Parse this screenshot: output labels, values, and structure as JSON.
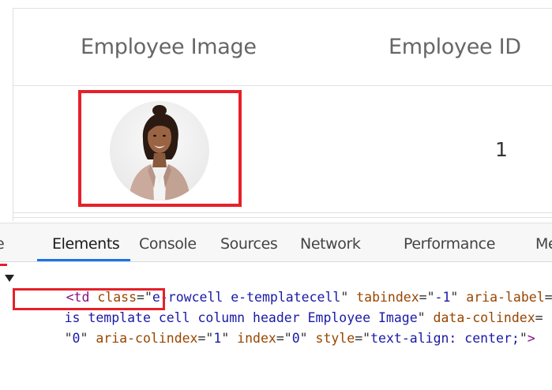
{
  "grid": {
    "columns": [
      {
        "label": "Employee Image"
      },
      {
        "label": "Employee ID"
      }
    ],
    "rows": [
      {
        "employee_id": "1",
        "image_icon": "employee-photo"
      }
    ]
  },
  "devtools": {
    "tabs": [
      {
        "label": "e",
        "partial": true
      },
      {
        "label": "Elements",
        "active": true
      },
      {
        "label": "Console"
      },
      {
        "label": "Sources"
      },
      {
        "label": "Network"
      },
      {
        "label": "Performance"
      },
      {
        "label": "Me",
        "partial": true
      }
    ],
    "code": {
      "line1": {
        "open": "<",
        "tag": "td",
        "a1_name": " class",
        "a1_eq": "=\"",
        "a1_val": "e-rowcell e-templatecell",
        "a1_end": "\"",
        "a2_name": " tabindex",
        "a2_eq": "=\"",
        "a2_val": "-1",
        "a2_end": "\"",
        "a3_name": " aria-label",
        "a3_eq": "="
      },
      "line2": {
        "highlighted": "is template cell",
        "rest_val": " column header Employee Image",
        "end": "\"",
        "a_name": " data-colindex",
        "a_eq": "="
      },
      "line3": {
        "start": "\"",
        "v1": "0",
        "q1": "\"",
        "a1_name": " aria-colindex",
        "a1_eq": "=\"",
        "a1_val": "1",
        "a1_end": "\"",
        "a2_name": " index",
        "a2_eq": "=\"",
        "a2_val": "0",
        "a2_end": "\"",
        "a3_name": " style",
        "a3_eq": "=\"",
        "a3_val": "text-align: center;",
        "a3_end": "\"",
        "close": ">"
      }
    }
  },
  "colors": {
    "highlight": "#e5212a",
    "active_tab": "#1a73e8"
  }
}
